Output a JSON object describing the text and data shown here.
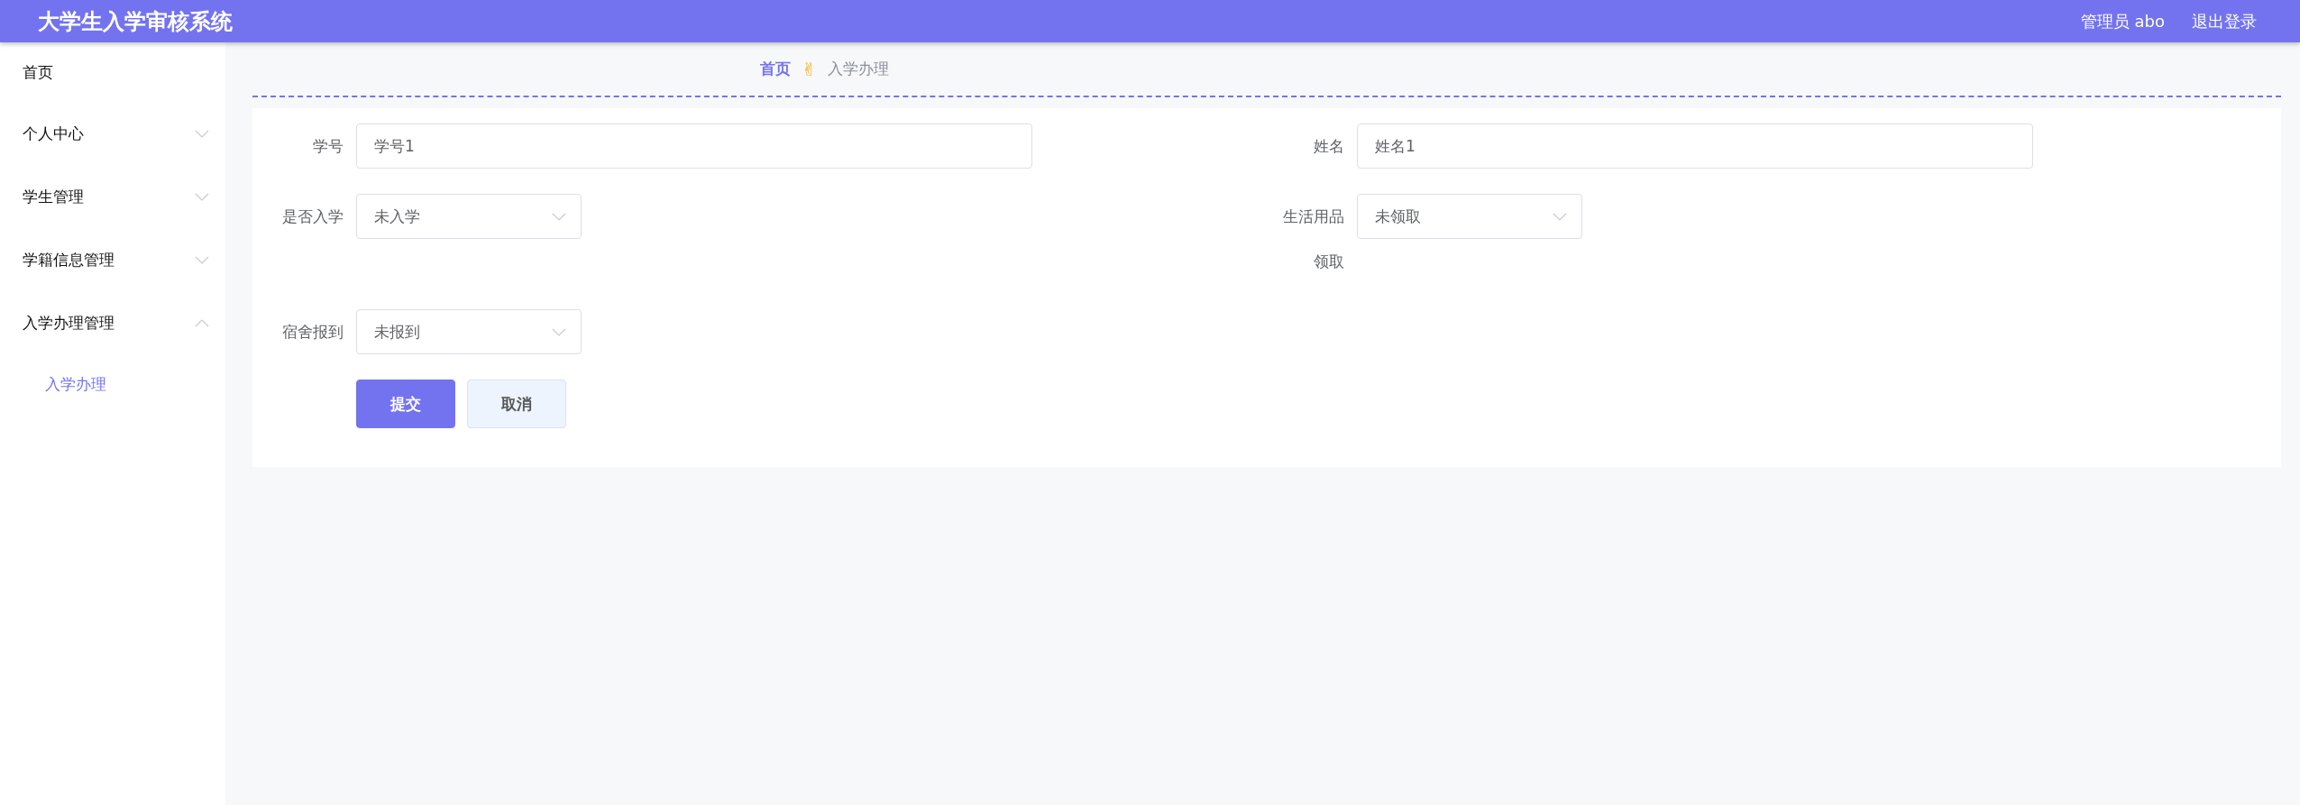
{
  "header": {
    "title": "大学生入学审核系统",
    "user": "管理员 abo",
    "logout": "退出登录"
  },
  "sidebar": {
    "items": [
      {
        "label": "首页"
      },
      {
        "label": "个人中心",
        "expanded": false
      },
      {
        "label": "学生管理",
        "expanded": false
      },
      {
        "label": "学籍信息管理",
        "expanded": false
      },
      {
        "label": "入学办理管理",
        "expanded": true,
        "children": [
          {
            "label": "入学办理",
            "selected": true
          }
        ]
      }
    ]
  },
  "breadcrumb": {
    "items": [
      {
        "label": "首页"
      },
      {
        "label": "入学办理"
      }
    ],
    "separator": "✌"
  },
  "form": {
    "fields": [
      {
        "label": "学号",
        "kind": "text",
        "value": "学号1"
      },
      {
        "label": "姓名",
        "kind": "text",
        "value": "姓名1"
      },
      {
        "label": "是否入学",
        "kind": "select",
        "value": "未入学"
      },
      {
        "label": "生活用品领取",
        "kind": "select",
        "value": "未领取"
      },
      {
        "label": "宿舍报到",
        "kind": "select",
        "value": "未报到"
      }
    ],
    "buttons": [
      {
        "label": "提交",
        "kind": "primary"
      },
      {
        "label": "取消",
        "kind": "default"
      }
    ]
  }
}
